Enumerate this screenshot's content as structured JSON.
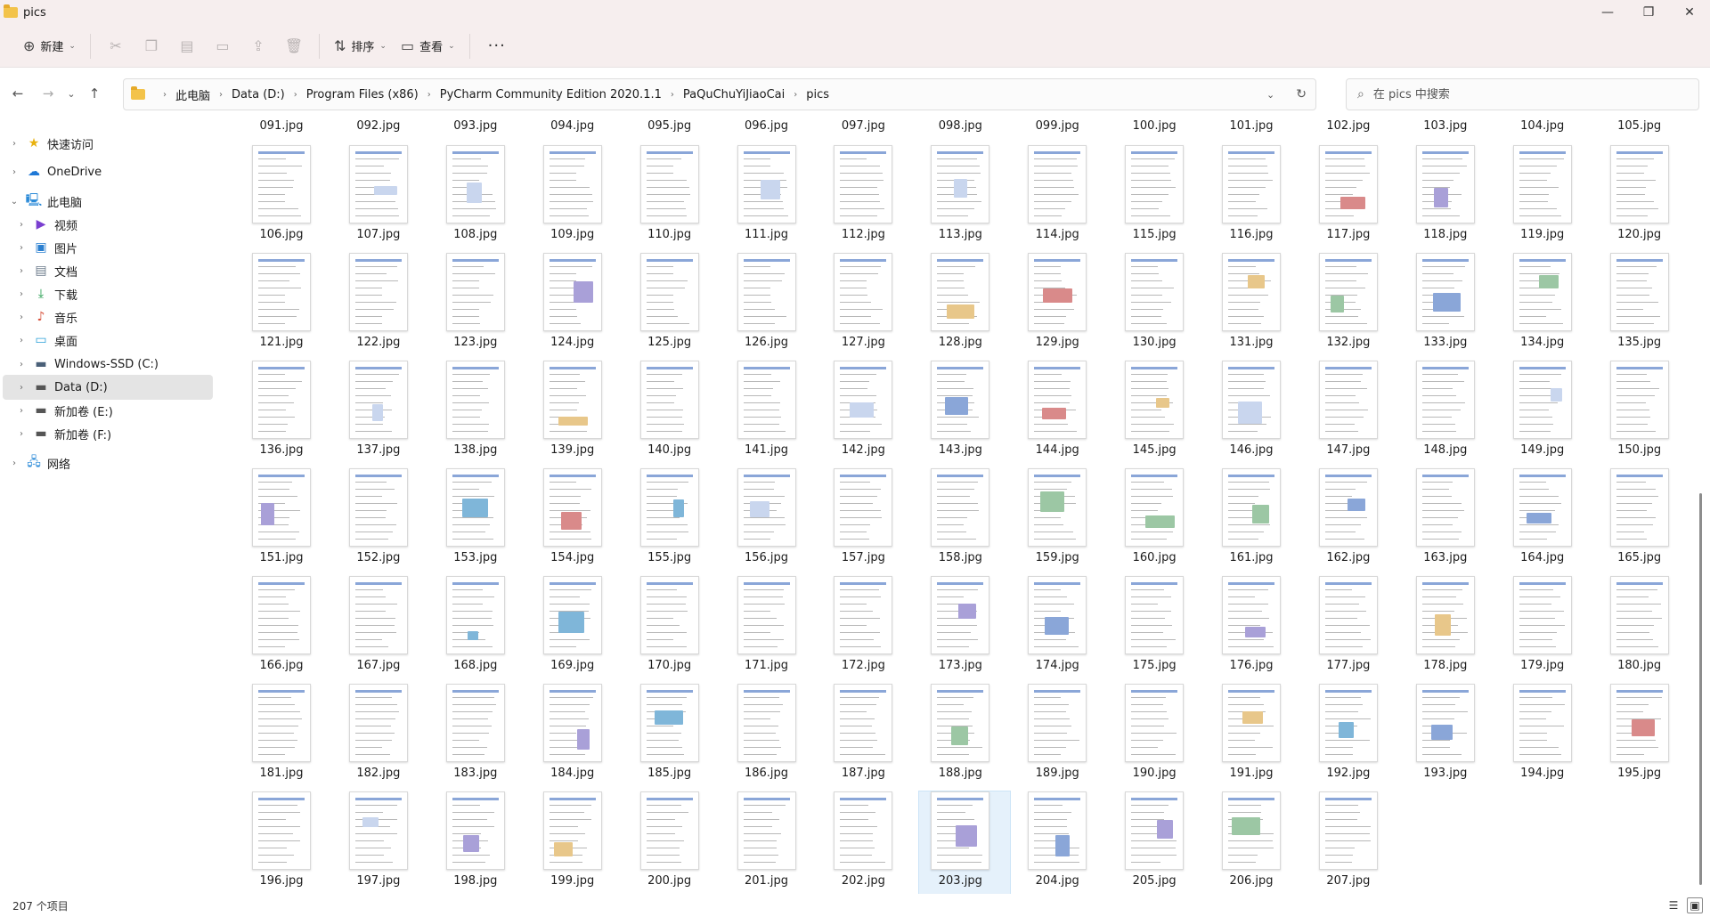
{
  "window": {
    "title": "pics",
    "minimize": "—",
    "maximize": "❐",
    "close": "✕"
  },
  "toolbar": {
    "new_label": "新建",
    "sort_label": "排序",
    "view_label": "查看",
    "more_label": "···"
  },
  "nav": {
    "back": "←",
    "forward": "→",
    "recent": "⌄",
    "up": "↑"
  },
  "breadcrumb": [
    "此电脑",
    "Data (D:)",
    "Program Files (x86)",
    "PyCharm Community Edition 2020.1.1",
    "PaQuChuYiJiaoCai",
    "pics"
  ],
  "search": {
    "placeholder": "在 pics 中搜索"
  },
  "sidebar": {
    "items": [
      {
        "label": "快速访问",
        "icon": "star-icon"
      },
      {
        "label": "OneDrive",
        "icon": "cloud-icon"
      },
      {
        "label": "此电脑",
        "icon": "computer-icon"
      },
      {
        "label": "视频",
        "icon": "video-icon"
      },
      {
        "label": "图片",
        "icon": "picture-icon"
      },
      {
        "label": "文档",
        "icon": "document-icon"
      },
      {
        "label": "下载",
        "icon": "download-icon"
      },
      {
        "label": "音乐",
        "icon": "music-icon"
      },
      {
        "label": "桌面",
        "icon": "desktop-icon"
      },
      {
        "label": "Windows-SSD (C:)",
        "icon": "drive-c-icon"
      },
      {
        "label": "Data (D:)",
        "icon": "drive-icon"
      },
      {
        "label": "新加卷 (E:)",
        "icon": "drive-icon"
      },
      {
        "label": "新加卷 (F:)",
        "icon": "drive-icon"
      },
      {
        "label": "网络",
        "icon": "network-icon"
      }
    ]
  },
  "files": {
    "top_row": [
      "091.jpg",
      "092.jpg",
      "093.jpg",
      "094.jpg",
      "095.jpg",
      "096.jpg",
      "097.jpg",
      "098.jpg",
      "099.jpg",
      "100.jpg",
      "101.jpg",
      "102.jpg",
      "103.jpg",
      "104.jpg",
      "105.jpg"
    ],
    "grid": [
      [
        "106.jpg",
        "107.jpg",
        "108.jpg",
        "109.jpg",
        "110.jpg",
        "111.jpg",
        "112.jpg",
        "113.jpg",
        "114.jpg",
        "115.jpg",
        "116.jpg",
        "117.jpg",
        "118.jpg",
        "119.jpg",
        "120.jpg"
      ],
      [
        "121.jpg",
        "122.jpg",
        "123.jpg",
        "124.jpg",
        "125.jpg",
        "126.jpg",
        "127.jpg",
        "128.jpg",
        "129.jpg",
        "130.jpg",
        "131.jpg",
        "132.jpg",
        "133.jpg",
        "134.jpg",
        "135.jpg"
      ],
      [
        "136.jpg",
        "137.jpg",
        "138.jpg",
        "139.jpg",
        "140.jpg",
        "141.jpg",
        "142.jpg",
        "143.jpg",
        "144.jpg",
        "145.jpg",
        "146.jpg",
        "147.jpg",
        "148.jpg",
        "149.jpg",
        "150.jpg"
      ],
      [
        "151.jpg",
        "152.jpg",
        "153.jpg",
        "154.jpg",
        "155.jpg",
        "156.jpg",
        "157.jpg",
        "158.jpg",
        "159.jpg",
        "160.jpg",
        "161.jpg",
        "162.jpg",
        "163.jpg",
        "164.jpg",
        "165.jpg"
      ],
      [
        "166.jpg",
        "167.jpg",
        "168.jpg",
        "169.jpg",
        "170.jpg",
        "171.jpg",
        "172.jpg",
        "173.jpg",
        "174.jpg",
        "175.jpg",
        "176.jpg",
        "177.jpg",
        "178.jpg",
        "179.jpg",
        "180.jpg"
      ],
      [
        "181.jpg",
        "182.jpg",
        "183.jpg",
        "184.jpg",
        "185.jpg",
        "186.jpg",
        "187.jpg",
        "188.jpg",
        "189.jpg",
        "190.jpg",
        "191.jpg",
        "192.jpg",
        "193.jpg",
        "194.jpg",
        "195.jpg"
      ],
      [
        "196.jpg",
        "197.jpg",
        "198.jpg",
        "199.jpg",
        "200.jpg",
        "201.jpg",
        "202.jpg",
        "203.jpg",
        "204.jpg",
        "205.jpg",
        "206.jpg",
        "207.jpg"
      ]
    ],
    "selected": "203.jpg"
  },
  "status": {
    "count": "207 个项目"
  },
  "colors": {
    "titlebar": "#f6eeee",
    "selection": "#e5f1fb",
    "folder": "#f3c34a"
  }
}
